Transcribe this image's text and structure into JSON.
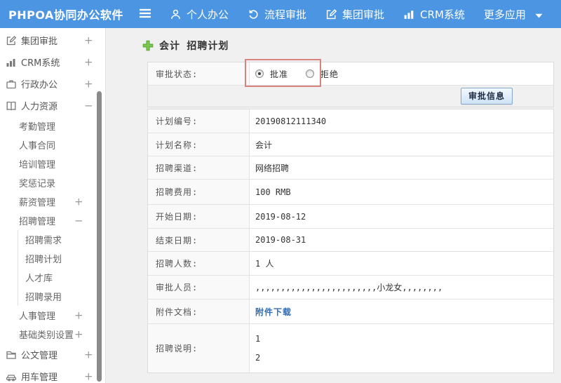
{
  "colors": {
    "navbar": "#4b95e2",
    "annotation": "#d9837e",
    "link": "#2f6db5"
  },
  "navbar": {
    "logo": "PHPOA协同办公软件",
    "items": [
      {
        "label": "个人办公",
        "icon": "user-icon"
      },
      {
        "label": "流程审批",
        "icon": "process-history-icon"
      },
      {
        "label": "集团审批",
        "icon": "edit-square-icon"
      },
      {
        "label": "CRM系统",
        "icon": "bar-chart-icon"
      },
      {
        "label": "更多应用",
        "icon": "caret-down-icon"
      }
    ]
  },
  "sidebar": {
    "items": [
      {
        "label": "集团审批",
        "icon": "edit-square-icon",
        "toggle": "+",
        "level": 0
      },
      {
        "label": "CRM系统",
        "icon": "bar-chart-icon",
        "toggle": "+",
        "level": 0
      },
      {
        "label": "行政办公",
        "icon": "briefcase-icon",
        "toggle": "+",
        "level": 0
      },
      {
        "label": "人力资源",
        "icon": "book-icon",
        "toggle": "−",
        "level": 0
      },
      {
        "label": "考勤管理",
        "level": 1
      },
      {
        "label": "人事合同",
        "level": 1
      },
      {
        "label": "培训管理",
        "level": 1
      },
      {
        "label": "奖惩记录",
        "level": 1
      },
      {
        "label": "薪资管理",
        "toggle": "+",
        "level": 1
      },
      {
        "label": "招聘管理",
        "toggle": "−",
        "level": 1
      },
      {
        "label": "招聘需求",
        "level": 2
      },
      {
        "label": "招聘计划",
        "level": 2
      },
      {
        "label": "人才库",
        "level": 2
      },
      {
        "label": "招聘录用",
        "level": 2
      },
      {
        "label": "人事管理",
        "toggle": "+",
        "level": 1
      },
      {
        "label": "基础类别设置",
        "toggle": "+",
        "level": 1
      },
      {
        "label": "公文管理",
        "icon": "folder-icon",
        "toggle": "+",
        "level": 0
      },
      {
        "label": "用车管理",
        "icon": "car-icon",
        "toggle": "+",
        "level": 0
      }
    ]
  },
  "main": {
    "title": "会计 招聘计划",
    "approval": {
      "label": "审批状态:",
      "options": [
        {
          "label": "批准",
          "selected": true
        },
        {
          "label": "拒绝",
          "selected": false
        }
      ],
      "button": "审批信息"
    },
    "fields": [
      {
        "label": "计划编号:",
        "value": "20190812111340"
      },
      {
        "label": "计划名称:",
        "value": "会计"
      },
      {
        "label": "招聘渠道:",
        "value": "网络招聘"
      },
      {
        "label": "招聘费用:",
        "value": "100 RMB"
      },
      {
        "label": "开始日期:",
        "value": "2019-08-12"
      },
      {
        "label": "结束日期:",
        "value": "2019-08-31"
      },
      {
        "label": "招聘人数:",
        "value": "1 人"
      },
      {
        "label": "审批人员:",
        "value": ",,,,,,,,,,,,,,,,,,,,,,,,小龙女,,,,,,,,"
      },
      {
        "label": "附件文档:",
        "value": "附件下载"
      },
      {
        "label": "招聘说明:",
        "value_lines": [
          "1",
          "2"
        ]
      }
    ]
  }
}
